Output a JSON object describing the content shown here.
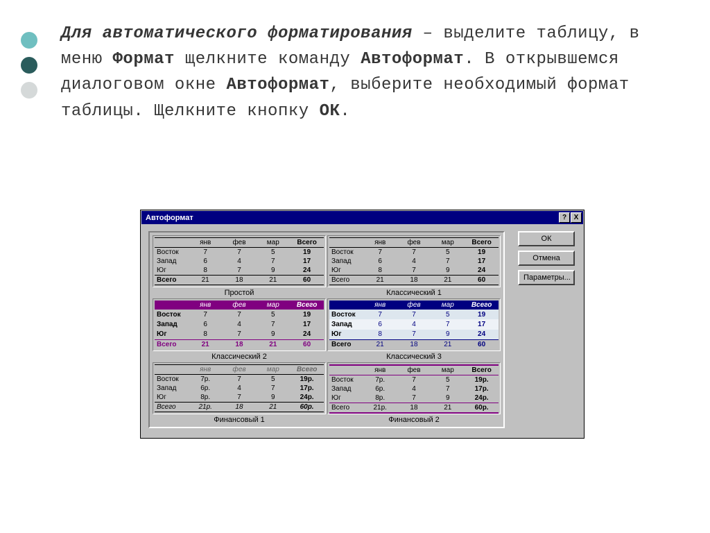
{
  "paragraph": {
    "p1": "Для автоматического форматирования",
    "p2": " – выделите таблицу, в меню ",
    "p3": "Формат",
    "p4": " щелкните команду ",
    "p5": "Автоформат",
    "p6": ". В открывшемся диалоговом окне ",
    "p7": "Автоформат",
    "p8": ", выберите необходимый формат таблицы. Щелкните кнопку ",
    "p9": "ОК",
    "p10": "."
  },
  "dialog": {
    "title": "Автоформат",
    "help": "?",
    "close": "X",
    "buttons": {
      "ok": "ОК",
      "cancel": "Отмена",
      "options": "Параметры..."
    },
    "previews": [
      {
        "caption": "Простой",
        "styleClass": "s-simple",
        "currency": false
      },
      {
        "caption": "Классический 1",
        "styleClass": "s-cls1",
        "currency": false
      },
      {
        "caption": "Классический 2",
        "styleClass": "s-cls2",
        "currency": false
      },
      {
        "caption": "Классический 3",
        "styleClass": "s-cls3",
        "currency": false
      },
      {
        "caption": "Финансовый 1",
        "styleClass": "s-fin1",
        "currency": true
      },
      {
        "caption": "Финансовый 2",
        "styleClass": "s-fin2",
        "currency": true
      }
    ],
    "sample": {
      "head": [
        "",
        "янв",
        "фев",
        "мар",
        "Всего"
      ],
      "rows": [
        [
          "Восток",
          7,
          7,
          5,
          19
        ],
        [
          "Запад",
          6,
          4,
          7,
          17
        ],
        [
          "Юг",
          8,
          7,
          9,
          24
        ]
      ],
      "foot": [
        "Всего",
        21,
        18,
        21,
        60
      ]
    }
  }
}
